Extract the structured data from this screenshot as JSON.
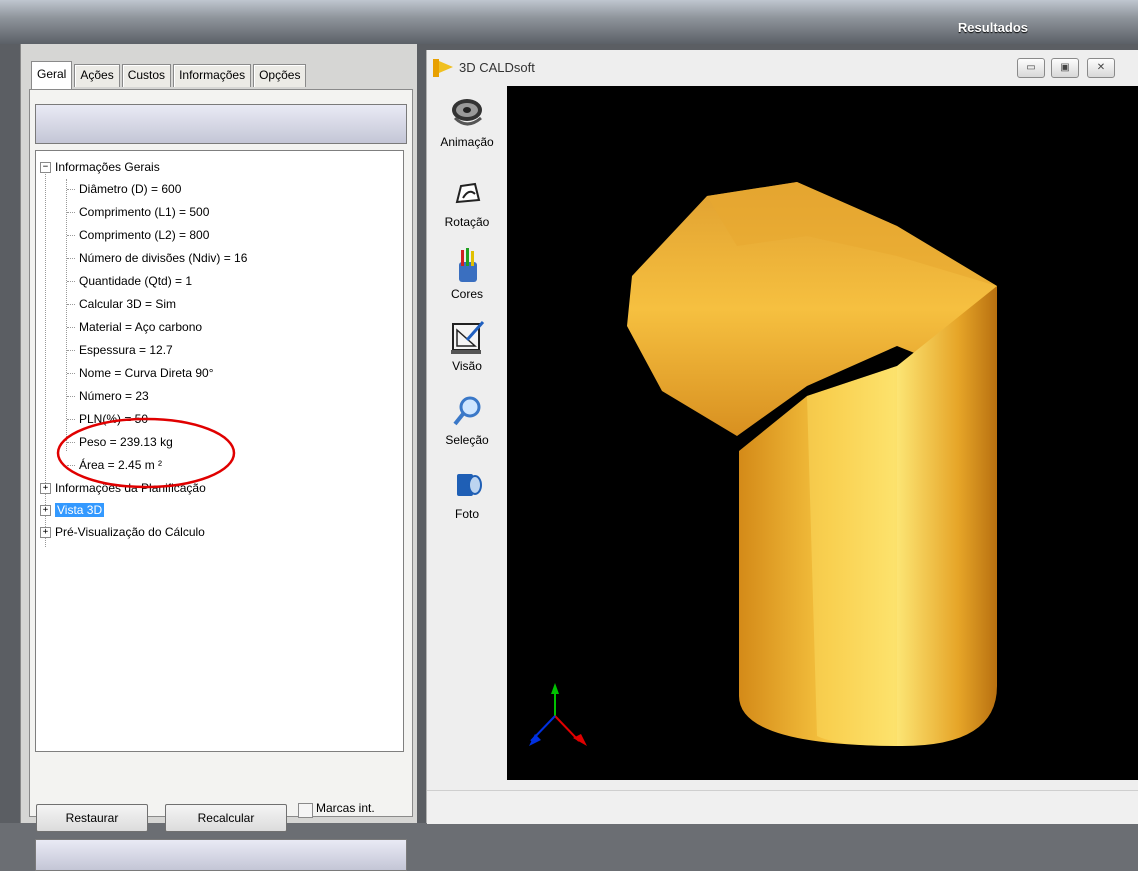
{
  "window": {
    "title": "Resultados"
  },
  "tabs": [
    {
      "label": "Geral",
      "active": true
    },
    {
      "label": "Ações",
      "active": false
    },
    {
      "label": "Custos",
      "active": false
    },
    {
      "label": "Informações",
      "active": false
    },
    {
      "label": "Opções",
      "active": false
    }
  ],
  "tree": {
    "root_info": "Informações Gerais",
    "items": [
      "Diâmetro (D) = 600",
      "Comprimento (L1) = 500",
      "Comprimento (L2) = 800",
      "Número de divisões (Ndiv) = 16",
      "Quantidade (Qtd) = 1",
      "Calcular 3D = Sim",
      "Material = Aço carbono",
      "Espessura = 12.7",
      "Nome = Curva Direta 90°",
      "Número = 23",
      "PLN(%) = 50",
      "Peso = 239.13 kg",
      "Área = 2.45 m ²"
    ],
    "node_planificacao": "Informações da Planificação",
    "node_vista3d": "Vista 3D",
    "node_previsualizacao": "Pré-Visualização do Cálculo"
  },
  "buttons": {
    "restaurar": "Restaurar",
    "recalcular": "Recalcular",
    "marcas_label": "Marcas int."
  },
  "viewer": {
    "title": "3D CALDsoft",
    "tools": [
      "Animação",
      "Rotação",
      "Cores",
      "Visão",
      "Seleção",
      "Foto"
    ]
  },
  "colors": {
    "highlight_circle": "#e00000",
    "model": "#f5b530",
    "selection": "#3399ff"
  }
}
